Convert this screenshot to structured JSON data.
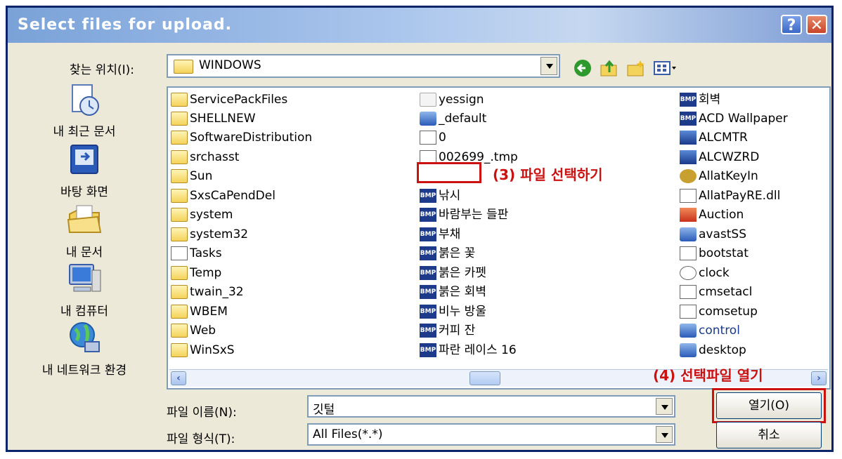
{
  "window": {
    "title": "Select files for upload.",
    "help_label": "?",
    "close_label": "✕"
  },
  "lookin": {
    "label": "찾는 위치(I):",
    "value": "WINDOWS"
  },
  "toolbar": {
    "icons": [
      "back-icon",
      "up-folder-icon",
      "new-folder-icon",
      "view-menu-icon"
    ]
  },
  "places": [
    {
      "label": "내 최근 문서",
      "icon": "recent-documents-icon"
    },
    {
      "label": "바탕 화면",
      "icon": "desktop-icon"
    },
    {
      "label": "내 문서",
      "icon": "my-documents-icon"
    },
    {
      "label": "내 컴퓨터",
      "icon": "my-computer-icon"
    },
    {
      "label": "내 네트워크 환경",
      "icon": "network-places-icon"
    }
  ],
  "files": {
    "col1": [
      "ServicePackFiles",
      "SHELLNEW",
      "SoftwareDistribution",
      "srchasst",
      "Sun",
      "SxsCaPendDel",
      "system",
      "system32",
      "Tasks",
      "Temp",
      "twain_32",
      "WBEM",
      "Web",
      "WinSxS"
    ],
    "col2": [
      "yessign",
      "_default",
      "0",
      "002699_.tmp",
      "",
      "낚시",
      "바람부는 들판",
      "부채",
      "붉은 꽃",
      "붉은 카펫",
      "붉은 회벽",
      "비누 방울",
      "커피 잔",
      "파란 레이스 16"
    ],
    "col3": [
      "회벽",
      "ACD Wallpaper",
      "ALCMTR",
      "ALCWZRD",
      "AllatKeyIn",
      "AllatPayRE.dll",
      "Auction",
      "avastSS",
      "bootstat",
      "clock",
      "cmsetacl",
      "comsetup",
      "control",
      "desktop"
    ]
  },
  "annotations": {
    "select_file": "(3) 파일 선택하기",
    "open_file": "(4) 선택파일 열기"
  },
  "filename": {
    "label": "파일 이름(N):",
    "value": "깃털"
  },
  "filetype": {
    "label": "파일 형식(T):",
    "value": "All Files(*.*)"
  },
  "buttons": {
    "open": "열기(O)",
    "cancel": "취소"
  }
}
